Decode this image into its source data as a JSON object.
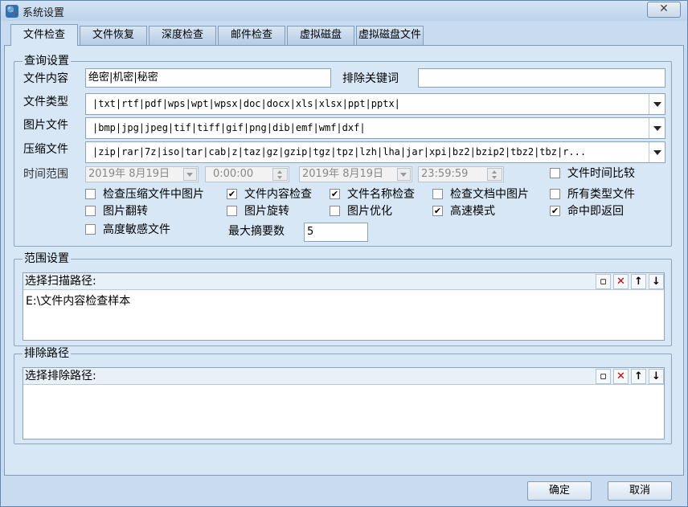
{
  "window": {
    "title": "系统设置",
    "close_label": "✕"
  },
  "tabs": [
    {
      "label": "文件检查"
    },
    {
      "label": "文件恢复"
    },
    {
      "label": "深度检查"
    },
    {
      "label": "邮件检查"
    },
    {
      "label": "虚拟磁盘"
    },
    {
      "label": "虚拟磁盘文件"
    }
  ],
  "query": {
    "group_title": "查询设置",
    "content_label": "文件内容",
    "content_value": "绝密|机密|秘密",
    "exclude_label": "排除关键词",
    "exclude_value": "",
    "filetype_label": "文件类型",
    "filetype_value": "|txt|rtf|pdf|wps|wpt|wpsx|doc|docx|xls|xlsx|ppt|pptx|",
    "image_label": "图片文件",
    "image_value": "|bmp|jpg|jpeg|tif|tiff|gif|png|dib|emf|wmf|dxf|",
    "archive_label": "压缩文件",
    "archive_value": "|zip|rar|7z|iso|tar|cab|z|taz|gz|gzip|tgz|tpz|lzh|lha|jar|xpi|bz2|bzip2|tbz2|tbz|r...",
    "time_label": "时间范围",
    "start_date": "2019年  8月19日",
    "start_time": "0:00:00",
    "end_date": "2019年  8月19日",
    "end_time": "23:59:59",
    "max_summary_label": "最大摘要数",
    "max_summary_value": "5",
    "checkboxes": {
      "time_compare": {
        "label": "文件时间比较",
        "checked": false
      },
      "check_archive_images": {
        "label": "检查压缩文件中图片",
        "checked": false
      },
      "content_check": {
        "label": "文件内容检查",
        "checked": true
      },
      "name_check": {
        "label": "文件名称检查",
        "checked": true
      },
      "check_doc_images": {
        "label": "检查文档中图片",
        "checked": false
      },
      "all_types": {
        "label": "所有类型文件",
        "checked": false
      },
      "image_flip": {
        "label": "图片翻转",
        "checked": false
      },
      "image_rotate": {
        "label": "图片旋转",
        "checked": false
      },
      "image_optimize": {
        "label": "图片优化",
        "checked": false
      },
      "high_speed": {
        "label": "高速模式",
        "checked": true
      },
      "return_on_hit": {
        "label": "命中即返回",
        "checked": true
      },
      "high_sensitive": {
        "label": "高度敏感文件",
        "checked": false
      }
    }
  },
  "scope": {
    "group_title": "范围设置",
    "list_header": "选择扫描路径:",
    "paths": [
      "E:\\文件内容检查样本"
    ]
  },
  "exclude": {
    "group_title": "排除路径",
    "list_header": "选择排除路径:",
    "paths": []
  },
  "toolbar": {
    "new_icon": "new-folder-icon",
    "delete_icon": "delete-icon",
    "up_icon": "arrow-up-icon",
    "down_icon": "arrow-down-icon",
    "delete_color": "#c00000"
  },
  "footer": {
    "ok_label": "确定",
    "cancel_label": "取消"
  }
}
